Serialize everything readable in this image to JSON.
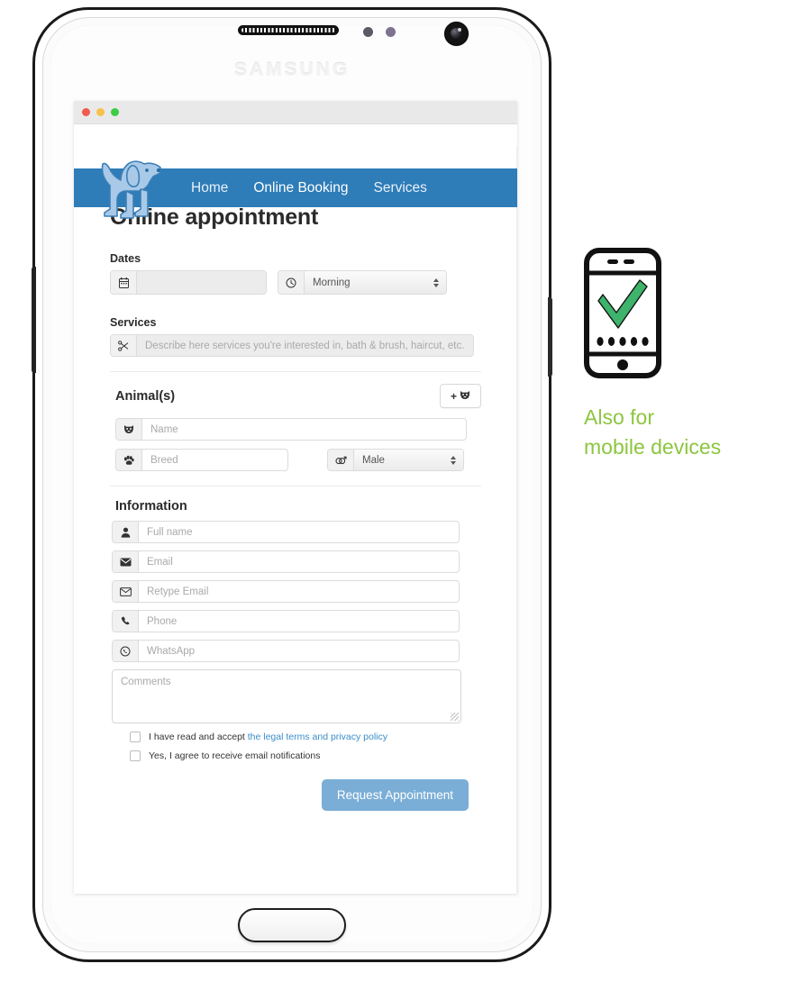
{
  "device": {
    "brand": "SAMSUNG",
    "speaker_icon": "speaker-grille-icon",
    "camera_icon": "front-camera-icon",
    "home_button": "home-button"
  },
  "browser": {
    "traffic_lights": [
      "red",
      "yellow",
      "green"
    ]
  },
  "site": {
    "logo_icon": "dog-logo-icon",
    "nav": [
      {
        "label": "Home",
        "active": false
      },
      {
        "label": "Online Booking",
        "active": true
      },
      {
        "label": "Services",
        "active": false
      }
    ],
    "nav_color": "#2e7cb8"
  },
  "page": {
    "title": "Online appointment",
    "sections": {
      "dates": {
        "heading": "Dates",
        "date_field": {
          "icon": "calendar-icon",
          "value": "",
          "placeholder": ""
        },
        "time_select": {
          "icon": "clock-icon",
          "value": "Morning"
        }
      },
      "services": {
        "heading": "Services",
        "field": {
          "icon": "scissors-icon",
          "value": "",
          "placeholder": "Describe here services you're interested in, bath & brush, haircut, etc."
        }
      },
      "animals": {
        "heading": "Animal(s)",
        "add_button": {
          "label": "+",
          "icon": "add-pet-icon"
        },
        "name_field": {
          "icon": "pet-face-icon",
          "value": "",
          "placeholder": "Name"
        },
        "breed_field": {
          "icon": "paw-icon",
          "value": "",
          "placeholder": "Breed"
        },
        "gender_select": {
          "icon": "gender-icon",
          "value": "Male"
        }
      },
      "information": {
        "heading": "Information",
        "fields": [
          {
            "icon": "user-icon",
            "placeholder": "Full name",
            "value": ""
          },
          {
            "icon": "envelope-icon",
            "placeholder": "Email",
            "value": ""
          },
          {
            "icon": "envelope-open-icon",
            "placeholder": "Retype Email",
            "value": ""
          },
          {
            "icon": "phone-icon",
            "placeholder": "Phone",
            "value": ""
          },
          {
            "icon": "whatsapp-icon",
            "placeholder": "WhatsApp",
            "value": ""
          }
        ],
        "comments": {
          "placeholder": "Comments",
          "value": ""
        }
      },
      "consent": {
        "terms_prefix": "I have read and accept ",
        "terms_link": "the legal terms and privacy policy",
        "newsletter": "Yes, I agree to receive email notifications",
        "link_color": "#3a8dc9"
      },
      "submit": {
        "label": "Request Appointment",
        "color": "#7aaed6"
      }
    }
  },
  "aside": {
    "icon": "mobile-phone-check-icon",
    "caption_line1": "Also for",
    "caption_line2": "mobile devices",
    "caption_color": "#8cc63f",
    "check_color": "#3db36b"
  }
}
